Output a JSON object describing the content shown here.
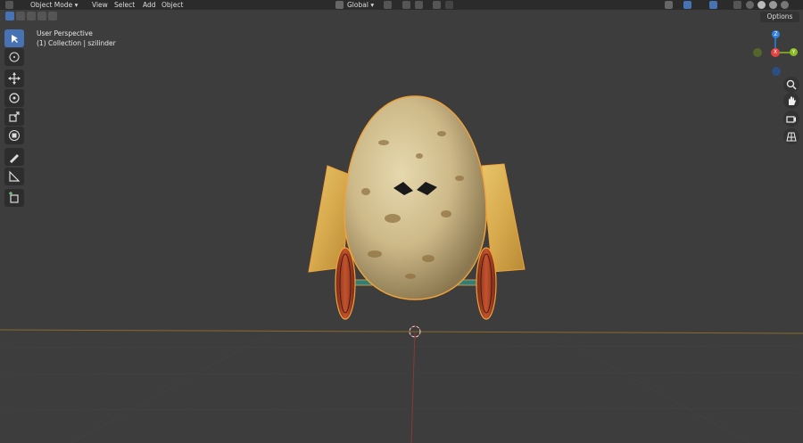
{
  "header": {
    "mode": "Object Mode",
    "menus": [
      "View",
      "Select",
      "Add",
      "Object"
    ],
    "transform_orientation": "Global",
    "options_label": "Options"
  },
  "viewport": {
    "view_name": "User Perspective",
    "collection_line": "(1) Collection | szilinder"
  },
  "gizmo": {
    "z_label": "Z",
    "x_label": "X",
    "y_label": "Y",
    "colors": {
      "x": "#e8413f",
      "y": "#8bbd23",
      "z": "#2f82dc"
    }
  },
  "tools": [
    "select-box-icon",
    "cursor-icon",
    "move-icon",
    "rotate-icon",
    "scale-icon",
    "transform-icon",
    "annotate-icon",
    "measure-icon",
    "add-cube-icon"
  ],
  "nav_buttons": [
    "zoom-icon",
    "pan-hand-icon",
    "camera-icon",
    "grid-view-icon"
  ],
  "theme": {
    "accent": "#4772b3",
    "background": "#3d3d3d",
    "selection_outline": "#f0a23a"
  }
}
